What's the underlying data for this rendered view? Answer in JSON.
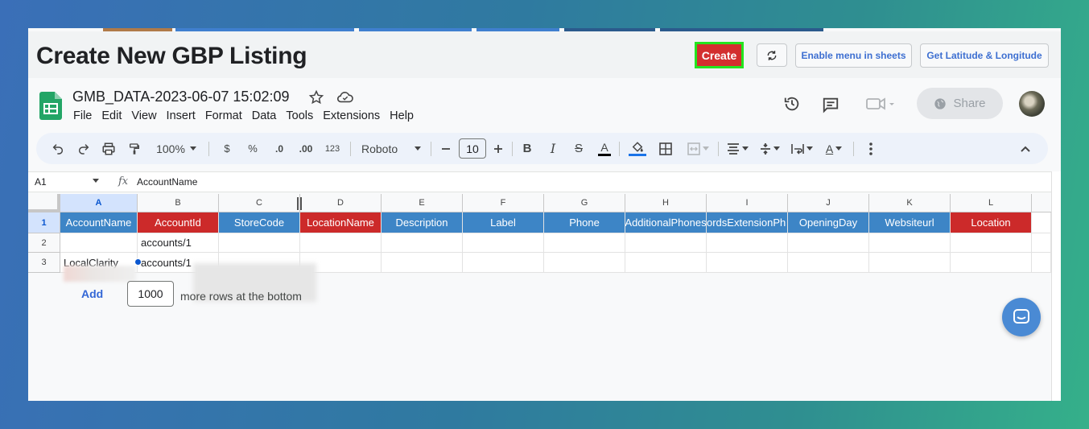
{
  "app": {
    "title": "Create New GBP Listing",
    "create_label": "Create",
    "enable_menu_label": "Enable menu in sheets",
    "latlong_label": "Get Latitude & Longitude"
  },
  "sheet": {
    "doc_title": "GMB_DATA-2023-06-07 15:02:09",
    "menu": [
      "File",
      "Edit",
      "View",
      "Insert",
      "Format",
      "Data",
      "Tools",
      "Extensions",
      "Help"
    ],
    "share_label": "Share"
  },
  "toolbar": {
    "zoom": "100%",
    "currency": "$",
    "percent": "%",
    "dec_decrease": ".0",
    "dec_increase": ".00",
    "number_format": "123",
    "font": "Roboto",
    "font_size": "10"
  },
  "formula": {
    "cell_ref": "A1",
    "fx": "fx",
    "value": "AccountName"
  },
  "grid": {
    "columns": [
      "A",
      "B",
      "C",
      "D",
      "E",
      "F",
      "G",
      "H",
      "I",
      "J",
      "K",
      "L"
    ],
    "rows": [
      "1",
      "2",
      "3"
    ],
    "headers": [
      "AccountName",
      "AccountId",
      "StoreCode",
      "LocationName",
      "Description",
      "Label",
      "Phone",
      "AdditionalPhones",
      "ordsExtensionPh",
      "OpeningDay",
      "Websiteurl",
      "Location"
    ],
    "header_colors": [
      "blue",
      "red",
      "blue",
      "red",
      "blue",
      "blue",
      "blue",
      "blue",
      "blue",
      "blue",
      "blue",
      "red"
    ],
    "row2": {
      "A": "",
      "B": "accounts/1"
    },
    "row3": {
      "A": "LocalClarity",
      "B": "accounts/1"
    }
  },
  "footer": {
    "add_label": "Add",
    "rows_value": "1000",
    "rows_text": "more rows at the bottom"
  },
  "colors": {
    "header_blue": "#3d85c6",
    "header_red": "#cc2a2a",
    "create_red": "#d32f2f",
    "create_border": "#22e51f",
    "link_blue": "#3d6fd1"
  },
  "icons": [
    "sheets-logo-icon",
    "star-icon",
    "cloud-icon",
    "history-icon",
    "comment-icon",
    "meet-icon",
    "globe-icon",
    "undo-icon",
    "redo-icon",
    "print-icon",
    "paint-format-icon",
    "bold-icon",
    "italic-icon",
    "strikethrough-icon",
    "text-color-icon",
    "fill-color-icon",
    "borders-icon",
    "merge-icon",
    "align-icon",
    "valign-icon",
    "wrap-icon",
    "rotate-icon",
    "more-icon",
    "collapse-icon",
    "refresh-icon",
    "chat-icon"
  ]
}
